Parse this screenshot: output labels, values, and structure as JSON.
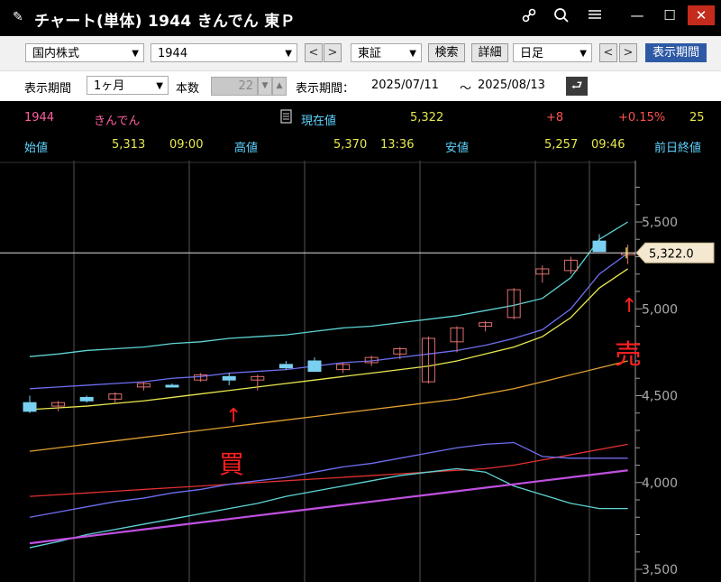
{
  "window": {
    "title": "チャート(単体) 1944 きんでん 東Ｐ",
    "icons": [
      "link-icon",
      "search-icon",
      "menu-icon"
    ],
    "controls": {
      "minimize": "—",
      "maximize": "☐",
      "close": "✕"
    }
  },
  "toolbar1": {
    "market": "国内株式",
    "code": "1944",
    "prev": "<",
    "next": ">",
    "exchange": "東証",
    "search": "検索",
    "detail": "詳細",
    "period_type": "日足",
    "prev2": "<",
    "next2": ">",
    "display_period_btn": "表示期間"
  },
  "toolbar2": {
    "period_label": "表示期間",
    "period_value": "1ヶ月",
    "count_label": "本数",
    "count_value": "22",
    "range_label": "表示期間：",
    "range_from": "2025/07/11",
    "range_sep": "〜",
    "range_to": "2025/08/13"
  },
  "quote": {
    "code": "1944",
    "name": "きんでん",
    "current_label": "現在値",
    "current_value": "5,322",
    "change": "+8",
    "change_pct": "+0.15%",
    "extra": "25",
    "open_label": "始値",
    "open_value": "5,313",
    "open_time": "09:00",
    "high_label": "高値",
    "high_value": "5,370",
    "high_time": "13:36",
    "low_label": "安値",
    "low_value": "5,257",
    "low_time": "09:46",
    "prev_close_label": "前日終値"
  },
  "chart_data": {
    "type": "candlestick",
    "y_ticks": [
      "5,500",
      "5,000",
      "4,500",
      "4,000",
      "3,500"
    ],
    "ylim": [
      3500,
      5500
    ],
    "current_price_label": "5,322.0",
    "current_price": 5322,
    "candles": [
      {
        "o": 4460,
        "h": 4500,
        "l": 4400,
        "c": 4410
      },
      {
        "o": 4440,
        "h": 4470,
        "l": 4410,
        "c": 4460
      },
      {
        "o": 4490,
        "h": 4500,
        "l": 4460,
        "c": 4470
      },
      {
        "o": 4480,
        "h": 4520,
        "l": 4460,
        "c": 4510
      },
      {
        "o": 4550,
        "h": 4580,
        "l": 4530,
        "c": 4570
      },
      {
        "o": 4560,
        "h": 4570,
        "l": 4550,
        "c": 4550
      },
      {
        "o": 4590,
        "h": 4630,
        "l": 4580,
        "c": 4620
      },
      {
        "o": 4610,
        "h": 4630,
        "l": 4560,
        "c": 4590
      },
      {
        "o": 4590,
        "h": 4620,
        "l": 4530,
        "c": 4610
      },
      {
        "o": 4680,
        "h": 4700,
        "l": 4650,
        "c": 4660
      },
      {
        "o": 4700,
        "h": 4720,
        "l": 4640,
        "c": 4640
      },
      {
        "o": 4650,
        "h": 4690,
        "l": 4630,
        "c": 4680
      },
      {
        "o": 4690,
        "h": 4730,
        "l": 4670,
        "c": 4720
      },
      {
        "o": 4740,
        "h": 4780,
        "l": 4710,
        "c": 4770
      },
      {
        "o": 4580,
        "h": 4840,
        "l": 4570,
        "c": 4830
      },
      {
        "o": 4810,
        "h": 4900,
        "l": 4750,
        "c": 4890
      },
      {
        "o": 4900,
        "h": 4930,
        "l": 4870,
        "c": 4920
      },
      {
        "o": 4950,
        "h": 5120,
        "l": 4940,
        "c": 5110
      },
      {
        "o": 5200,
        "h": 5250,
        "l": 5150,
        "c": 5230
      },
      {
        "o": 5220,
        "h": 5300,
        "l": 5200,
        "c": 5280
      },
      {
        "o": 5390,
        "h": 5430,
        "l": 5330,
        "c": 5330
      },
      {
        "o": 5313,
        "h": 5370,
        "l": 5257,
        "c": 5322
      }
    ],
    "series": [
      {
        "color": "#5fd4d4",
        "values": [
          4725,
          4740,
          4760,
          4770,
          4780,
          4800,
          4810,
          4830,
          4840,
          4850,
          4870,
          4890,
          4900,
          4920,
          4940,
          4960,
          4990,
          5020,
          5060,
          5180,
          5400,
          5500
        ]
      },
      {
        "color": "#6e6ef0",
        "values": [
          4540,
          4550,
          4560,
          4570,
          4580,
          4600,
          4610,
          4630,
          4640,
          4650,
          4670,
          4690,
          4700,
          4720,
          4740,
          4760,
          4790,
          4830,
          4880,
          5000,
          5200,
          5320
        ]
      },
      {
        "color": "#e8e850",
        "values": [
          4420,
          4430,
          4440,
          4455,
          4470,
          4490,
          4510,
          4530,
          4550,
          4570,
          4590,
          4610,
          4630,
          4650,
          4670,
          4700,
          4740,
          4780,
          4840,
          4950,
          5120,
          5230
        ]
      },
      {
        "color": "#e0a030",
        "values": [
          4180,
          4200,
          4220,
          4240,
          4260,
          4280,
          4300,
          4320,
          4340,
          4360,
          4380,
          4400,
          4420,
          4440,
          4460,
          4480,
          4510,
          4540,
          4580,
          4620,
          4660,
          4700
        ]
      },
      {
        "color": "#e03030",
        "values": [
          3920,
          3930,
          3940,
          3950,
          3960,
          3970,
          3980,
          3990,
          4000,
          4010,
          4020,
          4030,
          4040,
          4050,
          4060,
          4070,
          4080,
          4100,
          4130,
          4160,
          4190,
          4220
        ]
      },
      {
        "color": "#6e6ef0",
        "values": [
          3800,
          3830,
          3860,
          3890,
          3910,
          3940,
          3960,
          3990,
          4010,
          4030,
          4060,
          4090,
          4110,
          4140,
          4170,
          4200,
          4220,
          4230,
          4150,
          4140,
          4140,
          4140
        ]
      },
      {
        "color": "#5fd4d4",
        "values": [
          3625,
          3660,
          3700,
          3730,
          3760,
          3790,
          3820,
          3850,
          3880,
          3920,
          3950,
          3980,
          4010,
          4040,
          4060,
          4080,
          4060,
          3980,
          3930,
          3880,
          3850,
          3850
        ]
      },
      {
        "color": "#c050e0",
        "values": [
          3650,
          3670,
          3690,
          3710,
          3730,
          3750,
          3770,
          3790,
          3810,
          3830,
          3850,
          3870,
          3890,
          3910,
          3930,
          3950,
          3970,
          3990,
          4010,
          4030,
          4050,
          4070
        ]
      }
    ],
    "annotations": [
      {
        "text": "買",
        "color": "#ff2020"
      },
      {
        "text": "↑",
        "color": "#ff2020"
      },
      {
        "text": "売",
        "color": "#ff2020"
      },
      {
        "text": "↑",
        "color": "#ff2020"
      }
    ]
  }
}
